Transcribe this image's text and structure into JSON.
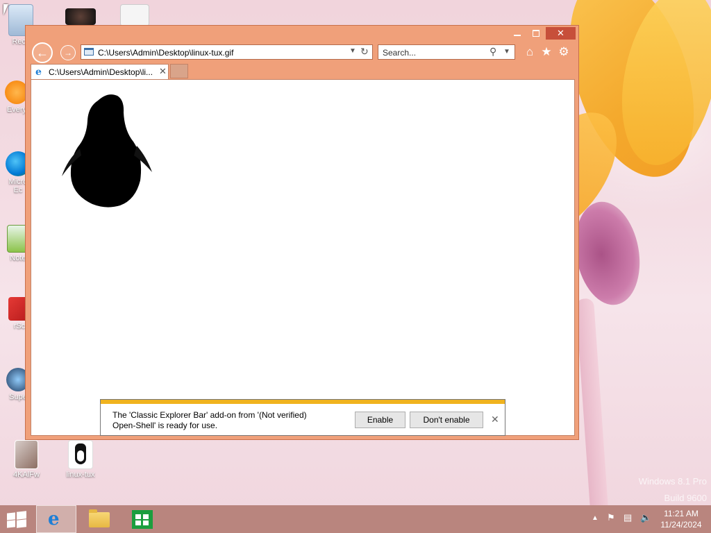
{
  "desktop": {
    "watermark_line1": "Windows 8.1 Pro",
    "watermark_line2": "Build 9600",
    "icons": [
      {
        "label": "Recy",
        "name": "recycle-bin"
      },
      {
        "label": "Every",
        "name": "everything"
      },
      {
        "label": "Micro",
        "label2": "Ec",
        "name": "microsoft-edge"
      },
      {
        "label": "Note",
        "name": "notepad"
      },
      {
        "label": "rSc",
        "name": "app-r"
      },
      {
        "label": "Supe",
        "name": "super-app"
      },
      {
        "label": "4KAlFw",
        "name": "4kalfw"
      },
      {
        "label": "linux-tux",
        "name": "linux-tux"
      }
    ]
  },
  "window": {
    "address": "C:\\Users\\Admin\\Desktop\\linux-tux.gif",
    "search_placeholder": "Search...",
    "tab_title": "C:\\Users\\Admin\\Desktop\\li...",
    "controls": {
      "minimize": "minimize",
      "maximize": "maximize",
      "close": "close"
    }
  },
  "notification": {
    "message_line1": "The 'Classic Explorer Bar' add-on from '(Not verified)",
    "message_line2": "Open-Shell' is ready for use.",
    "enable_label": "Enable",
    "dont_enable_label": "Don't enable",
    "close_glyph": "✕",
    "accent_color": "#f0b31f"
  },
  "taskbar": {
    "time": "11:21 AM",
    "date": "11/24/2024",
    "apps": [
      "internet-explorer",
      "file-explorer",
      "store"
    ]
  }
}
